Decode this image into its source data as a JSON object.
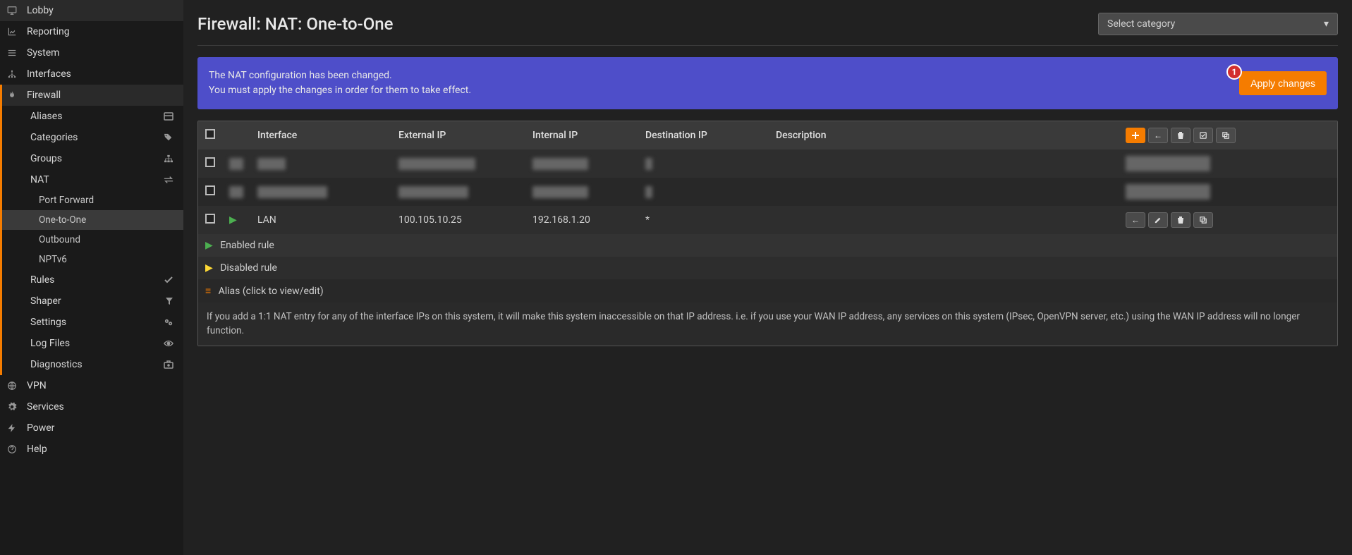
{
  "sidebar": {
    "top": [
      {
        "label": "Lobby",
        "icon": "monitor"
      },
      {
        "label": "Reporting",
        "icon": "chart"
      },
      {
        "label": "System",
        "icon": "menu"
      },
      {
        "label": "Interfaces",
        "icon": "network"
      }
    ],
    "firewall_label": "Firewall",
    "firewall": [
      {
        "label": "Aliases",
        "right": "card"
      },
      {
        "label": "Categories",
        "right": "tags"
      },
      {
        "label": "Groups",
        "right": "sitemap"
      },
      {
        "label": "NAT",
        "right": "swap",
        "sub": [
          {
            "label": "Port Forward"
          },
          {
            "label": "One-to-One",
            "selected": true
          },
          {
            "label": "Outbound"
          },
          {
            "label": "NPTv6"
          }
        ]
      },
      {
        "label": "Rules",
        "right": "check"
      },
      {
        "label": "Shaper",
        "right": "filter"
      },
      {
        "label": "Settings",
        "right": "gears"
      },
      {
        "label": "Log Files",
        "right": "eye"
      },
      {
        "label": "Diagnostics",
        "right": "briefcase"
      }
    ],
    "bottom": [
      {
        "label": "VPN",
        "icon": "globe"
      },
      {
        "label": "Services",
        "icon": "gear"
      },
      {
        "label": "Power",
        "icon": "plug"
      },
      {
        "label": "Help",
        "icon": "question"
      }
    ]
  },
  "page": {
    "title": "Firewall: NAT: One-to-One",
    "category_placeholder": "Select category"
  },
  "alert": {
    "line1": "The NAT configuration has been changed.",
    "line2": "You must apply the changes in order for them to take effect.",
    "badge": "1",
    "apply": "Apply changes"
  },
  "table": {
    "headers": [
      "",
      "",
      "Interface",
      "External IP",
      "Internal IP",
      "Destination IP",
      "Description",
      ""
    ],
    "rows": [
      {
        "status": "enabled",
        "redacted": true,
        "interface": "████",
        "external": "███████████",
        "internal": "████████",
        "dest": "█",
        "desc": ""
      },
      {
        "status": "enabled",
        "redacted": true,
        "interface": "██████████",
        "external": "██████████",
        "internal": "████████",
        "dest": "█",
        "desc": ""
      },
      {
        "status": "enabled",
        "redacted": false,
        "interface": "LAN",
        "external": "100.105.10.25",
        "internal": "192.168.1.20",
        "dest": "*",
        "desc": ""
      }
    ]
  },
  "legend": {
    "enabled": "Enabled rule",
    "disabled": "Disabled rule",
    "alias": "Alias (click to view/edit)"
  },
  "hint": "If you add a 1:1 NAT entry for any of the interface IPs on this system, it will make this system inaccessible on that IP address. i.e. if you use your WAN IP address, any services on this system (IPsec, OpenVPN server, etc.) using the WAN IP address will no longer function."
}
